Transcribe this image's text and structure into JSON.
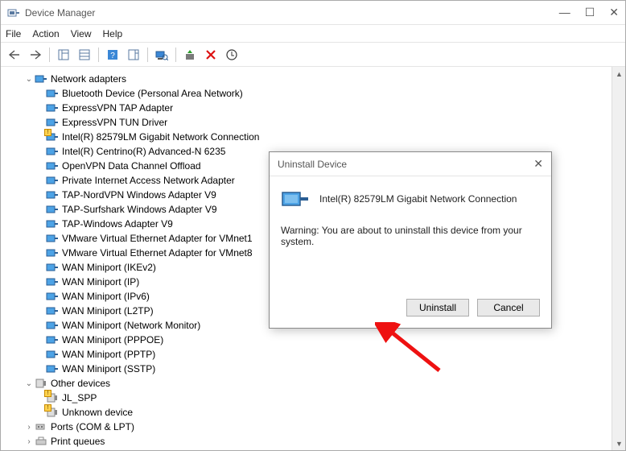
{
  "window": {
    "title": "Device Manager"
  },
  "menu": {
    "file": "File",
    "action": "Action",
    "view": "View",
    "help": "Help"
  },
  "tree": {
    "category": "Network adapters",
    "items": [
      "Bluetooth Device (Personal Area Network)",
      "ExpressVPN TAP Adapter",
      "ExpressVPN TUN Driver",
      "Intel(R) 82579LM Gigabit Network Connection",
      "Intel(R) Centrino(R) Advanced-N 6235",
      "OpenVPN Data Channel Offload",
      "Private Internet Access Network Adapter",
      "TAP-NordVPN Windows Adapter V9",
      "TAP-Surfshark Windows Adapter V9",
      "TAP-Windows Adapter V9",
      "VMware Virtual Ethernet Adapter for VMnet1",
      "VMware Virtual Ethernet Adapter for VMnet8",
      "WAN Miniport (IKEv2)",
      "WAN Miniport (IP)",
      "WAN Miniport (IPv6)",
      "WAN Miniport (L2TP)",
      "WAN Miniport (Network Monitor)",
      "WAN Miniport (PPPOE)",
      "WAN Miniport (PPTP)",
      "WAN Miniport (SSTP)"
    ],
    "other_category": "Other devices",
    "other_items": [
      "JL_SPP",
      "Unknown device"
    ],
    "ports_category": "Ports (COM & LPT)",
    "print_category": "Print queues"
  },
  "dialog": {
    "title": "Uninstall Device",
    "device_name": "Intel(R) 82579LM Gigabit Network Connection",
    "warning": "Warning: You are about to uninstall this device from your system.",
    "uninstall_label": "Uninstall",
    "cancel_label": "Cancel"
  }
}
